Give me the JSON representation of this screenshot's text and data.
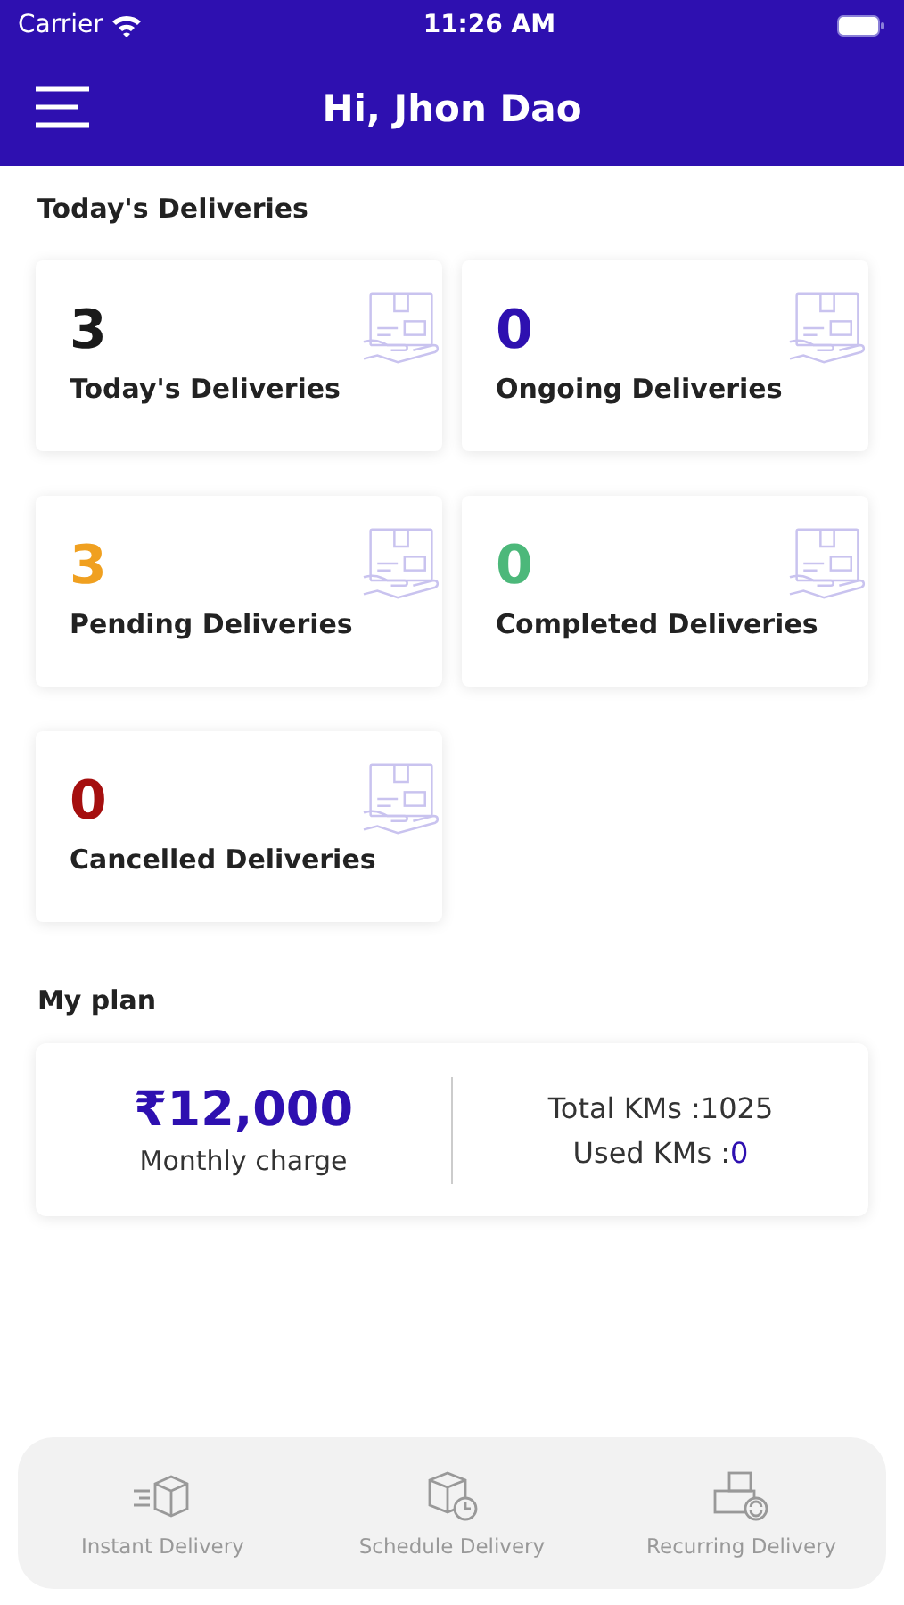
{
  "status_bar": {
    "carrier": "Carrier",
    "time": "11:26 AM"
  },
  "header": {
    "title": "Hi, Jhon Dao"
  },
  "deliveries": {
    "title": "Today's Deliveries",
    "cards": [
      {
        "count": "3",
        "label": "Today's Deliveries",
        "color": "#1a1a1a"
      },
      {
        "count": "0",
        "label": "Ongoing Deliveries",
        "color": "#2e10b0"
      },
      {
        "count": "3",
        "label": "Pending Deliveries",
        "color": "#f0a020"
      },
      {
        "count": "0",
        "label": "Completed Deliveries",
        "color": "#4cb87a"
      },
      {
        "count": "0",
        "label": "Cancelled Deliveries",
        "color": "#a50f0f"
      }
    ]
  },
  "plan": {
    "title": "My plan",
    "amount": "₹12,000",
    "amount_label": "Monthly charge",
    "total_label": "Total KMs :",
    "total_value": "1025",
    "used_label": "Used KMs :",
    "used_value": "0"
  },
  "bottom_nav": [
    {
      "label": "Instant Delivery",
      "kind": "instant"
    },
    {
      "label": "Schedule Delivery",
      "kind": "schedule"
    },
    {
      "label": "Recurring Delivery",
      "kind": "recurring"
    }
  ]
}
